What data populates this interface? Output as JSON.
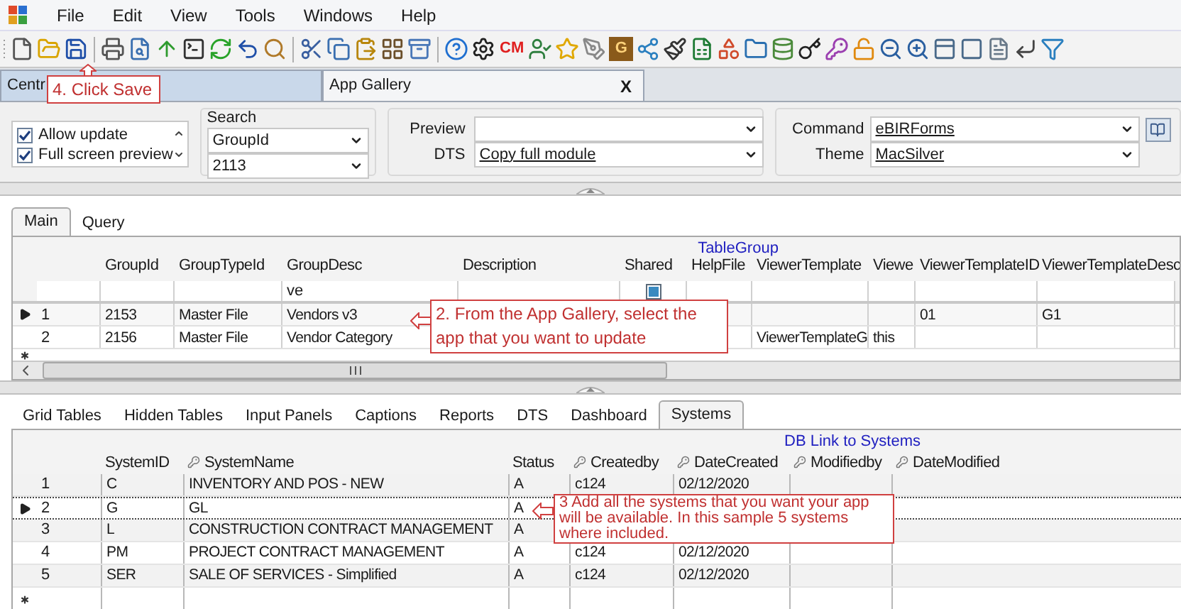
{
  "menu": [
    "File",
    "Edit",
    "View",
    "Tools",
    "Windows",
    "Help"
  ],
  "toolbar_badges": [
    {
      "text": "CM"
    },
    {
      "text": "G"
    }
  ],
  "document_tabs": [
    {
      "label": "Centr",
      "selected": false
    },
    {
      "label": "App Gallery",
      "selected": true,
      "close": "X"
    }
  ],
  "options": {
    "checklist": [
      {
        "label": "Allow update",
        "checked": true
      },
      {
        "label": "Full screen preview",
        "checked": true
      }
    ],
    "search": {
      "label": "Search",
      "fields": [
        "GroupId",
        "2113"
      ]
    },
    "preview": {
      "label": "Preview"
    },
    "dts": {
      "label": "DTS",
      "value": "Copy full module"
    },
    "command": {
      "label": "Command",
      "value": "eBIRForms"
    },
    "theme": {
      "label": "Theme",
      "value": "MacSilver"
    }
  },
  "upper_tabs": [
    {
      "label": "Main",
      "selected": true
    },
    {
      "label": "Query",
      "selected": false
    }
  ],
  "table_group": {
    "title": "TableGroup",
    "columns": [
      "GroupId",
      "GroupTypeId",
      "GroupDesc",
      "Description",
      "Shared",
      "HelpFile",
      "ViewerTemplate",
      "Viewe",
      "ViewerTemplateID",
      "ViewerTemplateDesc"
    ],
    "filter": {
      "cells": [
        null,
        null,
        "ve",
        null,
        null,
        null,
        null,
        null,
        null,
        null
      ],
      "shared_checked": true
    },
    "rows": [
      {
        "number": "1",
        "selected": true,
        "cells": [
          "2153",
          "Master File",
          "Vendors v3",
          null,
          null,
          null,
          null,
          null,
          "01",
          "G1"
        ]
      },
      {
        "number": "2",
        "selected": false,
        "cells": [
          "2156",
          "Master File",
          "Vendor Category",
          null,
          null,
          null,
          "ViewerTemplateG",
          "this",
          null,
          null
        ]
      }
    ]
  },
  "lower_tabs": [
    {
      "label": "Grid Tables",
      "selected": false
    },
    {
      "label": "Hidden Tables",
      "selected": false
    },
    {
      "label": "Input Panels",
      "selected": false
    },
    {
      "label": "Captions",
      "selected": false
    },
    {
      "label": "Reports",
      "selected": false
    },
    {
      "label": "DTS",
      "selected": false
    },
    {
      "label": "Dashboard",
      "selected": false
    },
    {
      "label": "Systems",
      "selected": true
    }
  ],
  "systems_table": {
    "title": "DB Link to Systems",
    "columns": [
      {
        "label": "SystemID",
        "key": false
      },
      {
        "label": "SystemName",
        "key": true
      },
      {
        "label": "Status",
        "key": false
      },
      {
        "label": "Createdby",
        "key": true
      },
      {
        "label": "DateCreated",
        "key": true
      },
      {
        "label": "Modifiedby",
        "key": true
      },
      {
        "label": "DateModified",
        "key": true
      }
    ],
    "rows": [
      {
        "number": "1",
        "selected": false,
        "cells": [
          "C",
          "INVENTORY AND POS - NEW",
          "A",
          "c124",
          "02/12/2020",
          null,
          null
        ]
      },
      {
        "number": "2",
        "selected": true,
        "cells": [
          "G",
          "GL",
          "A",
          null,
          null,
          null,
          null
        ]
      },
      {
        "number": "3",
        "selected": false,
        "cells": [
          "L",
          "CONSTRUCTION CONTRACT MANAGEMENT",
          "A",
          null,
          null,
          null,
          null
        ]
      },
      {
        "number": "4",
        "selected": false,
        "cells": [
          "PM",
          "PROJECT CONTRACT MANAGEMENT",
          "A",
          "c124",
          "02/12/2020",
          null,
          null
        ]
      },
      {
        "number": "5",
        "selected": false,
        "cells": [
          "SER",
          "SALE OF SERVICES - Simplified",
          "A",
          "c124",
          "02/12/2020",
          null,
          null
        ]
      }
    ]
  },
  "annotations": [
    {
      "kind": "up",
      "text": "4. Click Save"
    },
    {
      "kind": "left",
      "text": "2.  From the App Gallery, select the app that you want to update"
    },
    {
      "kind": "left",
      "text": "3  Add all the systems that you want your app will be available. In this sample 5 systems where included."
    }
  ]
}
